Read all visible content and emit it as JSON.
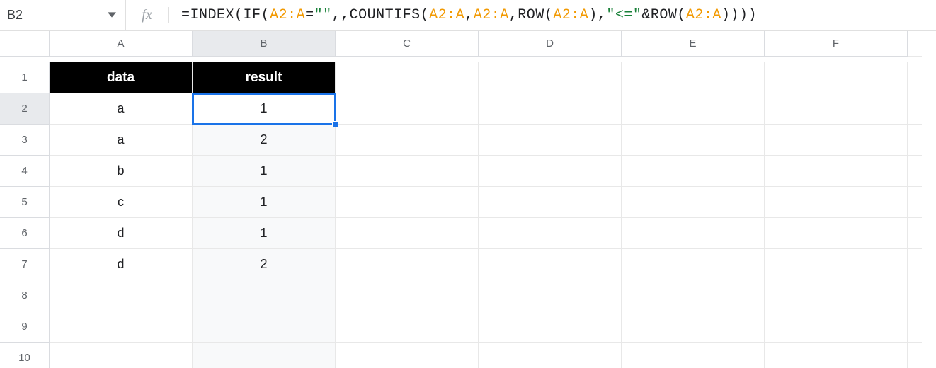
{
  "name_box": {
    "value": "B2"
  },
  "formula": {
    "tokens": [
      {
        "t": "=",
        "c": "tok-op"
      },
      {
        "t": "INDEX",
        "c": "tok-fn"
      },
      {
        "t": "(",
        "c": "tok-punc"
      },
      {
        "t": "IF",
        "c": "tok-fn"
      },
      {
        "t": "(",
        "c": "tok-punc"
      },
      {
        "t": "A2:A",
        "c": "tok-ref"
      },
      {
        "t": "=",
        "c": "tok-op"
      },
      {
        "t": "\"\"",
        "c": "tok-str"
      },
      {
        "t": ",,",
        "c": "tok-punc"
      },
      {
        "t": "COUNTIFS",
        "c": "tok-fn"
      },
      {
        "t": "(",
        "c": "tok-punc"
      },
      {
        "t": "A2:A",
        "c": "tok-ref"
      },
      {
        "t": ",",
        "c": "tok-punc"
      },
      {
        "t": "A2:A",
        "c": "tok-ref"
      },
      {
        "t": ",",
        "c": "tok-punc"
      },
      {
        "t": "ROW",
        "c": "tok-fn"
      },
      {
        "t": "(",
        "c": "tok-punc"
      },
      {
        "t": "A2:A",
        "c": "tok-ref"
      },
      {
        "t": ")",
        "c": "tok-punc"
      },
      {
        "t": ",",
        "c": "tok-punc"
      },
      {
        "t": "\"<=\"",
        "c": "tok-str"
      },
      {
        "t": "&",
        "c": "tok-op"
      },
      {
        "t": "ROW",
        "c": "tok-fn"
      },
      {
        "t": "(",
        "c": "tok-punc"
      },
      {
        "t": "A2:A",
        "c": "tok-ref"
      },
      {
        "t": ")",
        "c": "tok-punc"
      },
      {
        "t": ")",
        "c": "tok-punc"
      },
      {
        "t": ")",
        "c": "tok-punc"
      },
      {
        "t": ")",
        "c": "tok-punc"
      }
    ]
  },
  "columns": [
    "A",
    "B",
    "C",
    "D",
    "E",
    "F"
  ],
  "rows": [
    "1",
    "2",
    "3",
    "4",
    "5",
    "6",
    "7",
    "8",
    "9",
    "10"
  ],
  "active": {
    "col": "B",
    "row": "2"
  },
  "headers": {
    "A": "data",
    "B": "result"
  },
  "data": [
    {
      "A": "a",
      "B": "1"
    },
    {
      "A": "a",
      "B": "2"
    },
    {
      "A": "b",
      "B": "1"
    },
    {
      "A": "c",
      "B": "1"
    },
    {
      "A": "d",
      "B": "1"
    },
    {
      "A": "d",
      "B": "2"
    }
  ]
}
